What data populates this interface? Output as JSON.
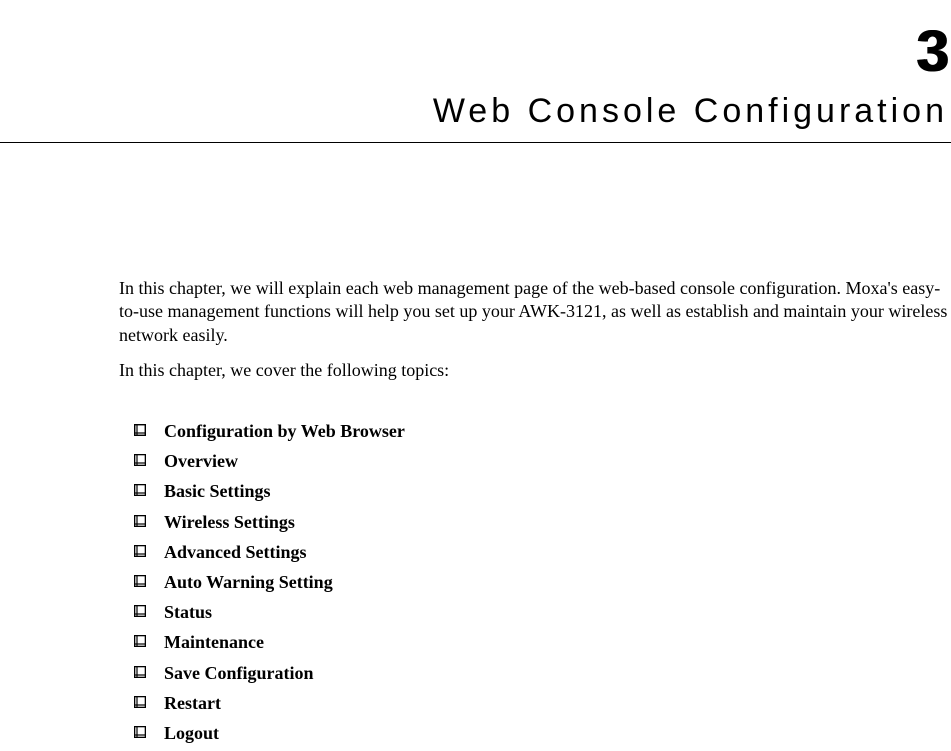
{
  "chapter": {
    "number": "3",
    "title": "Web Console Configuration"
  },
  "intro": {
    "para1": "In this chapter, we will explain each web management page of the web-based console configuration. Moxa's easy-to-use management functions will help you set up your AWK-3121, as well as establish and maintain your wireless network easily.",
    "para2": "In this chapter, we cover the following topics:"
  },
  "topics": [
    {
      "label": "Configuration by Web Browser"
    },
    {
      "label": "Overview"
    },
    {
      "label": "Basic Settings"
    },
    {
      "label": "Wireless Settings"
    },
    {
      "label": "Advanced Settings"
    },
    {
      "label": "Auto Warning Setting"
    },
    {
      "label": "Status"
    },
    {
      "label": "Maintenance"
    },
    {
      "label": "Save Configuration"
    },
    {
      "label": "Restart"
    },
    {
      "label": "Logout"
    }
  ]
}
